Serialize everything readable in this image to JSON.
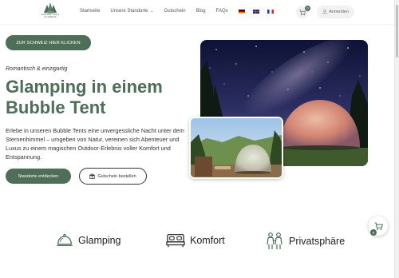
{
  "header": {
    "logo_text_line1": "BUBBLE TENT",
    "logo_text_line2": "SCHWEIZ",
    "nav": [
      {
        "label": "Startseite"
      },
      {
        "label": "Unsere Standorte",
        "has_dropdown": true
      },
      {
        "label": "Gutschein"
      },
      {
        "label": "Blog"
      },
      {
        "label": "FAQs"
      }
    ],
    "languages": [
      "de",
      "en",
      "fr"
    ],
    "cart_count": "0",
    "login_label": "Anmelden"
  },
  "hero": {
    "swiss_button": "ZUR SCHWEIZ HIER KLICKEN",
    "tagline": "Romantisch & einzigartig",
    "headline": "Glamping in einem Bubble Tent",
    "description": "Erlebe in unseren  Bubble Tents eine unvergessliche Nacht unter dem Sternenhimmel – umgeben von Natur, vereinen sich Abenteuer und Luxus zu einem magischen Outdoor-Erlebnis voller Komfort und Entspannung.",
    "primary_button": "Standorte entdecken",
    "secondary_button": "Gutschein bestellen"
  },
  "floating_cart": {
    "count": "0"
  },
  "features": [
    {
      "label": "Glamping",
      "icon": "cloche-icon"
    },
    {
      "label": "Komfort",
      "icon": "bed-icon"
    },
    {
      "label": "Privatsphäre",
      "icon": "couple-icon"
    }
  ],
  "colors": {
    "brand": "#4d6e57",
    "text": "#2b2b2b"
  }
}
